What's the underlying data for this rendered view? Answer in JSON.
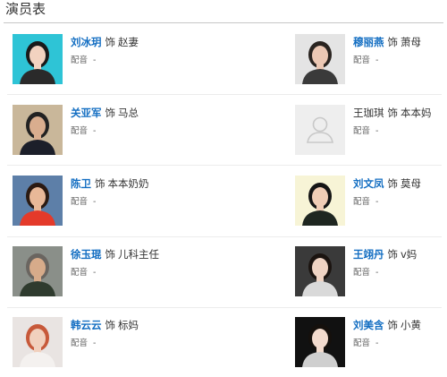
{
  "section_title": "演员表",
  "as_label": "饰",
  "dub_label": "配音",
  "dub_value": "-",
  "cast": [
    {
      "actor": "刘冰玥",
      "role": "赵妻",
      "linked": true,
      "bg": "#2ec4d6",
      "skin": "#f2d2c0",
      "hair": "#1a1a1a",
      "clothes": "#2a2a2a"
    },
    {
      "actor": "穆丽燕",
      "role": "萧母",
      "linked": true,
      "bg": "#e4e4e4",
      "skin": "#ecc8b4",
      "hair": "#2a2420",
      "clothes": "#3a3a3a"
    },
    {
      "actor": "关亚军",
      "role": "马总",
      "linked": true,
      "bg": "#c9b79a",
      "skin": "#d9ad8e",
      "hair": "#222",
      "clothes": "#1c1f2a"
    },
    {
      "actor": "王珈琪",
      "role": "本本妈",
      "linked": false,
      "placeholder": true
    },
    {
      "actor": "陈卫",
      "role": "本本奶奶",
      "linked": true,
      "bg": "#5d7fa8",
      "skin": "#e8b898",
      "hair": "#2b1a12",
      "clothes": "#e43a2a"
    },
    {
      "actor": "刘文凤",
      "role": "莫母",
      "linked": true,
      "bg": "#f7f4d6",
      "skin": "#f0cdb6",
      "hair": "#151515",
      "clothes": "#1e2620"
    },
    {
      "actor": "徐玉琨",
      "role": "儿科主任",
      "linked": true,
      "bg": "#8a8f89",
      "skin": "#d7ab8a",
      "hair": "#6a6560",
      "clothes": "#2f3b2e"
    },
    {
      "actor": "王翊丹",
      "role": "v妈",
      "linked": true,
      "bg": "#3a3a3a",
      "skin": "#efd3c3",
      "hair": "#1b1410",
      "clothes": "#d9d9d9"
    },
    {
      "actor": "韩云云",
      "role": "标妈",
      "linked": true,
      "bg": "#e9e4e2",
      "skin": "#f1d0bd",
      "hair": "#c7593a",
      "clothes": "#f4f1ef"
    },
    {
      "actor": "刘美含",
      "role": "小黄",
      "linked": true,
      "bg": "#111111",
      "skin": "#f3dbcd",
      "hair": "#15100c",
      "clothes": "#cfcfcf"
    }
  ]
}
